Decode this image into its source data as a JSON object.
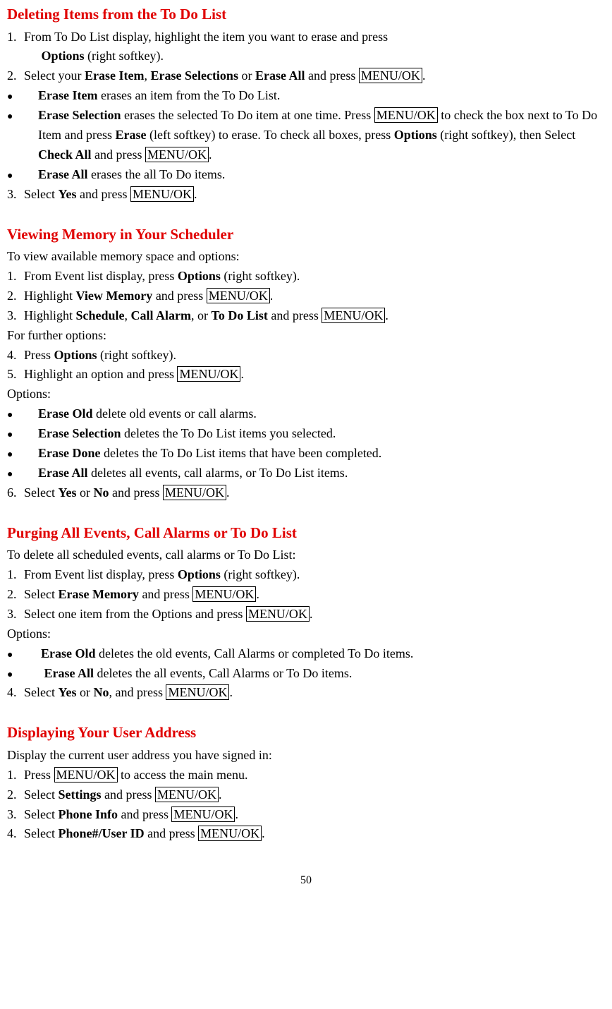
{
  "sec1": {
    "title": "Deleting Items from the To Do List",
    "li1_a": "From To Do List display, highlight the item you want to erase and press",
    "li1_b": "Options",
    "li1_c": " (right softkey).",
    "li2_a": "Select your ",
    "li2_b": "Erase Item",
    "li2_c": ", ",
    "li2_d": "Erase Selections",
    "li2_e": " or ",
    "li2_f": "Erase All",
    "li2_g": " and press ",
    "li2_h": "MENU/OK",
    "li2_i": ".",
    "b1_a": "Erase Item",
    "b1_b": " erases an item from the To Do List.",
    "b2_a": "Erase Selection",
    "b2_b": " erases the selected To Do item at one time. Press ",
    "b2_c": "MENU/OK",
    "b2_d": " to check the box next to To Do Item and press ",
    "b2_e": "Erase",
    "b2_f": " (left softkey) to erase. To check all boxes, press ",
    "b2_g": "Options",
    "b2_h": " (right softkey), then Select ",
    "b2_i": "Check All",
    "b2_j": " and press ",
    "b2_k": "MENU/OK",
    "b2_l": ".",
    "b3_a": "Erase All",
    "b3_b": " erases the all To Do items.",
    "li3_a": "Select ",
    "li3_b": "Yes",
    "li3_c": " and press ",
    "li3_d": "MENU/OK",
    "li3_e": "."
  },
  "sec2": {
    "title": "Viewing Memory in Your Scheduler",
    "p1": "To view available memory space and options:",
    "li1_a": "From Event list display, press ",
    "li1_b": "Options",
    "li1_c": " (right softkey).",
    "li2_a": "Highlight ",
    "li2_b": "View Memory",
    "li2_c": " and press ",
    "li2_d": "MENU/OK",
    "li2_e": ".",
    "li3_a": "Highlight ",
    "li3_b": "Schedule",
    "li3_c": ", ",
    "li3_d": "Call Alarm",
    "li3_e": ", or ",
    "li3_f": "To Do List",
    "li3_g": " and press ",
    "li3_h": "MENU/OK",
    "li3_i": ".",
    "p2": "For further options:",
    "li4_a": "Press ",
    "li4_b": "Options",
    "li4_c": " (right softkey).",
    "li5_a": "Highlight an option and press ",
    "li5_b": "MENU/OK",
    "li5_c": ".",
    "p3": "Options:",
    "b1_a": "Erase Old",
    "b1_b": " delete old events or call alarms.",
    "b2_a": "Erase Selection",
    "b2_b": " deletes the To Do List items you selected.",
    "b3_a": "Erase Done",
    "b3_b": " deletes the To Do List items that have been completed.",
    "b4_a": "Erase All",
    "b4_b": " deletes all events, call alarms, or To Do List items.",
    "li6_a": "Select ",
    "li6_b": "Yes",
    "li6_c": " or ",
    "li6_d": "No",
    "li6_e": " and press ",
    "li6_f": "MENU/OK",
    "li6_g": "."
  },
  "sec3": {
    "title": "Purging All Events, Call Alarms or To Do List",
    "p1": "To delete all scheduled events, call alarms or To Do List:",
    "li1_a": "From Event list display, press ",
    "li1_b": "Options",
    "li1_c": " (right softkey).",
    "li2_a": "Select ",
    "li2_b": "Erase Memory",
    "li2_c": " and press ",
    "li2_d": "MENU/OK",
    "li2_e": ".",
    "li3_a": "Select one item from the Options and press ",
    "li3_b": "MENU/OK",
    "li3_c": ".",
    "p2": "Options:",
    "b1_a": "Erase Old",
    "b1_b": " deletes the old events, Call Alarms or completed To Do items.",
    "b2_a": "Erase All",
    "b2_b": " deletes the all events, Call Alarms or To Do items.",
    "li4_a": "Select ",
    "li4_b": "Yes",
    "li4_c": " or ",
    "li4_d": "No",
    "li4_e": ", and press ",
    "li4_f": "MENU/OK",
    "li4_g": "."
  },
  "sec4": {
    "title": "Displaying Your User Address",
    "p1": "Display the current user address you have signed in:",
    "li1_a": "Press ",
    "li1_b": "MENU/OK",
    "li1_c": " to access the main menu.",
    "li2_a": "Select ",
    "li2_b": "Settings",
    "li2_c": " and press ",
    "li2_d": "MENU/OK",
    "li2_e": ".",
    "li3_a": "Select ",
    "li3_b": "Phone Info",
    "li3_c": " and press ",
    "li3_d": "MENU/OK",
    "li3_e": ".",
    "li4_a": "Select ",
    "li4_b": "Phone#/User ID",
    "li4_c": " and press ",
    "li4_d": "MENU/OK",
    "li4_e": "."
  },
  "page_number": "50"
}
